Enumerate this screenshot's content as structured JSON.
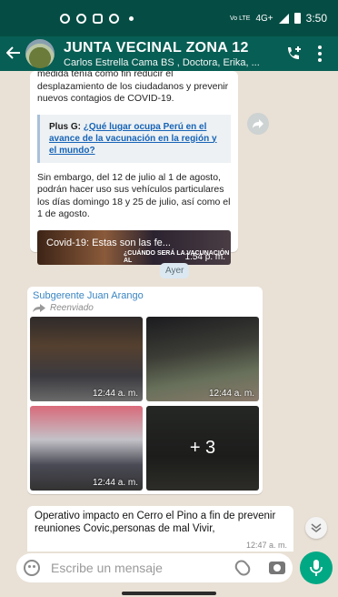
{
  "status_bar": {
    "time": "3:50",
    "network": "4G+",
    "signal_label": "Vo LTE"
  },
  "header": {
    "back_icon": "back-arrow-icon",
    "title": "JUNTA VECINAL ZONA 12",
    "subtitle": "Carlos Estrella Cama BS , Doctora, Erika, ...",
    "call_icon": "add-call-icon",
    "menu_icon": "kebab-menu-icon"
  },
  "messages": {
    "m1": {
      "text_top": "medida tenía como fin reducir el desplazamiento de los ciudadanos y prevenir nuevos contagios de COVID-19.",
      "quote_prefix": "Plus G:",
      "quote_link": "¿Qué lugar ocupa Perú en el avance de la vacunación en la región y el mundo?",
      "text_bottom": "Sin embargo, del 12 de julio al 1 de agosto, podrán hacer uso sus vehículos particulares los días domingo 18 y 25 de julio, así como el 1 de agosto.",
      "video_title": "Covid-19: Estas son las fe...",
      "video_caption": "¿CUÁNDO SERÁ LA VACUNACIÓN AL",
      "time": "1:54 p. m."
    },
    "day_chip": "Ayer",
    "m2": {
      "sender": "Subgerente Juan Arango",
      "forwarded": "Reenviado",
      "photos": [
        {
          "time": "12:44 a. m."
        },
        {
          "time": "12:44 a. m."
        },
        {
          "time": "12:44 a. m."
        },
        {
          "more": "+ 3"
        }
      ]
    },
    "m3": {
      "text": "Operativo  impacto en Cerro el  Pino  a fin de prevenir reuniones Covic,personas de mal Vivir,",
      "time": "12:47 a. m."
    }
  },
  "composer": {
    "placeholder": "Escribe un mensaje",
    "emoji_icon": "emoji-icon",
    "attach_icon": "paperclip-icon",
    "camera_icon": "camera-icon",
    "mic_icon": "microphone-icon"
  },
  "colors": {
    "header": "#075e54",
    "status_bar": "#054d44",
    "chat_bg": "#e9e1d6",
    "accent": "#00a884",
    "sender": "#3a85c3"
  }
}
